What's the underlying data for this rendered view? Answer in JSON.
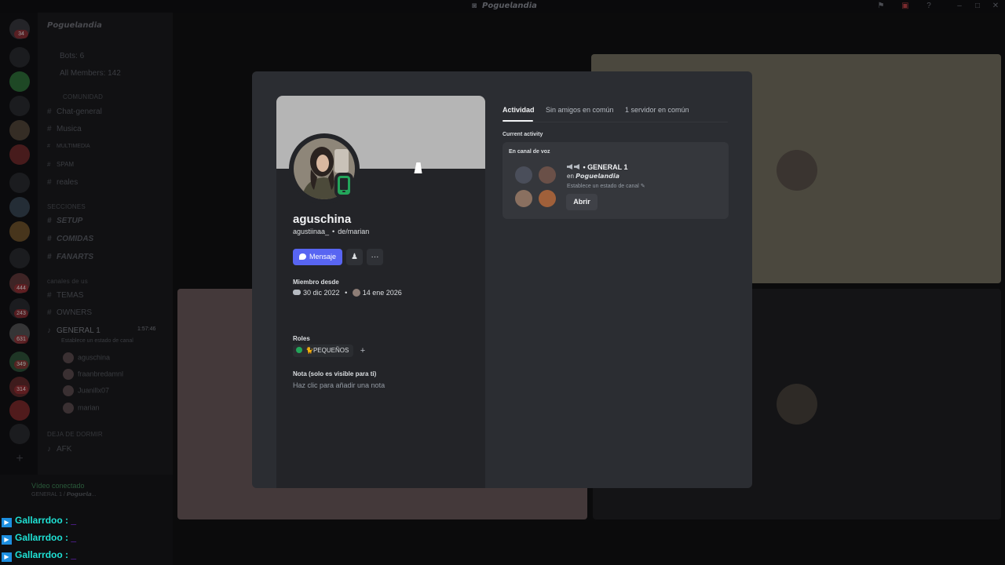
{
  "window": {
    "title": "𝙋𝙤𝙜𝙪𝙚𝙡𝙖𝙣𝙙𝙞𝙖"
  },
  "sidebar": {
    "server_name": "𝙋𝙤𝙜𝙪𝙚𝙡𝙖𝙣𝙙𝙞𝙖",
    "rows": [
      {
        "text": "Bots: 6"
      },
      {
        "text": "All Members: 142"
      }
    ],
    "categories": {
      "comunidad": "COMUNIDAD",
      "secciones": "SECCIONES",
      "canales": "canales de us",
      "deja": "DEJA DE DORMIR"
    },
    "channels": {
      "chat": "Chat-general",
      "musica": "Musica",
      "multimedia": "MULTIMEDIA",
      "spam": "SPAM",
      "reales": "reales",
      "setup": "SETUP",
      "comidas": "COMIDAS",
      "fanarts": "FANARTS",
      "temas": "TEMAS",
      "owners": "OWNERS",
      "general1": "GENERAL 1",
      "general1_status": "Establece un estado de canal",
      "general1_time": "1:57:46",
      "afk": "AFK"
    },
    "voice_users": [
      "aguschina",
      "fraanbredamnl",
      "Juanillx07",
      "marian"
    ],
    "server_badges": [
      "34",
      "444",
      "243",
      "631",
      "349",
      "314"
    ]
  },
  "userpanel": {
    "status": "Vídeo conectado",
    "sub": "GENERAL 1 / 𝙋𝙤𝙜𝙪𝙚𝙡𝙖..."
  },
  "chat": [
    {
      "name": "Gallarrdoo :",
      "msg": "_"
    },
    {
      "name": "Gallarrdoo :",
      "msg": "_"
    },
    {
      "name": "Gallarrdoo :",
      "msg": "_"
    }
  ],
  "profile": {
    "display_name": "aguschina",
    "username": "agustiinaa_",
    "pronouns": "de/marian",
    "message_button": "Mensaje",
    "member_since_label": "Miembro desde",
    "discord_date": "30 dic 2022",
    "server_date": "14 ene 2026",
    "roles_label": "Roles",
    "role": "🐈PEQUEÑOS",
    "add_role": "+",
    "note_label": "Nota (solo es visible para ti)",
    "note_placeholder": "Haz clic para añadir una nota",
    "banner_color": "#b5b5b5",
    "status_color": "#23a55a"
  },
  "tabs": [
    {
      "label": "Actividad",
      "active": true
    },
    {
      "label": "Sin amigos en común",
      "active": false
    },
    {
      "label": "1 servidor en común",
      "active": false
    }
  ],
  "activity": {
    "section_label": "Current activity",
    "card_title": "En canal de voz",
    "channel": "• GENERAL 1",
    "server_prefix": "en",
    "server": "𝙋𝙤𝙜𝙪𝙚𝙡𝙖𝙣𝙙𝙞𝙖",
    "status": "Establece un estado de canal",
    "open_button": "Abrir"
  },
  "colors": {
    "accent": "#5865f2",
    "online": "#23a55a"
  }
}
